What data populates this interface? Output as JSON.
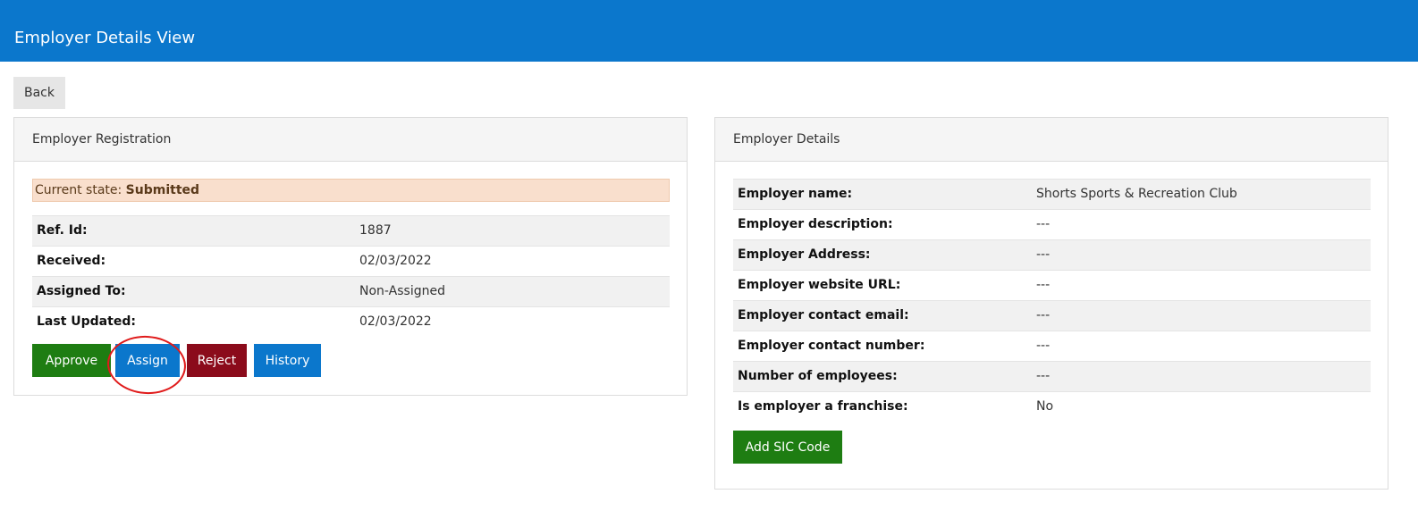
{
  "header": {
    "title": "Employer Details View"
  },
  "toolbar": {
    "back_label": "Back"
  },
  "registration": {
    "panel_title": "Employer Registration",
    "state_label": "Current state:",
    "state_value": "Submitted",
    "rows": [
      {
        "label": "Ref. Id:",
        "value": "1887"
      },
      {
        "label": "Received:",
        "value": "02/03/2022"
      },
      {
        "label": "Assigned To:",
        "value": "Non-Assigned"
      },
      {
        "label": "Last Updated:",
        "value": "02/03/2022"
      }
    ],
    "actions": {
      "approve": "Approve",
      "assign": "Assign",
      "reject": "Reject",
      "history": "History"
    }
  },
  "details": {
    "panel_title": "Employer Details",
    "rows": [
      {
        "label": "Employer name:",
        "value": "Shorts Sports & Recreation Club"
      },
      {
        "label": "Employer description:",
        "value": "---"
      },
      {
        "label": "Employer Address:",
        "value": "---"
      },
      {
        "label": "Employer website URL:",
        "value": "---"
      },
      {
        "label": "Employer contact email:",
        "value": "---"
      },
      {
        "label": "Employer contact number:",
        "value": "---"
      },
      {
        "label": "Number of employees:",
        "value": "---"
      },
      {
        "label": "Is employer a franchise:",
        "value": "No"
      }
    ],
    "add_sic_label": "Add SIC Code"
  },
  "colors": {
    "header_bg": "#0b77cc",
    "approve": "#1e7d12",
    "assign": "#0b77cc",
    "reject": "#8b0b1b",
    "history": "#0b77cc",
    "state_bg": "#f9dfcd",
    "annotation": "#e01b1b"
  }
}
